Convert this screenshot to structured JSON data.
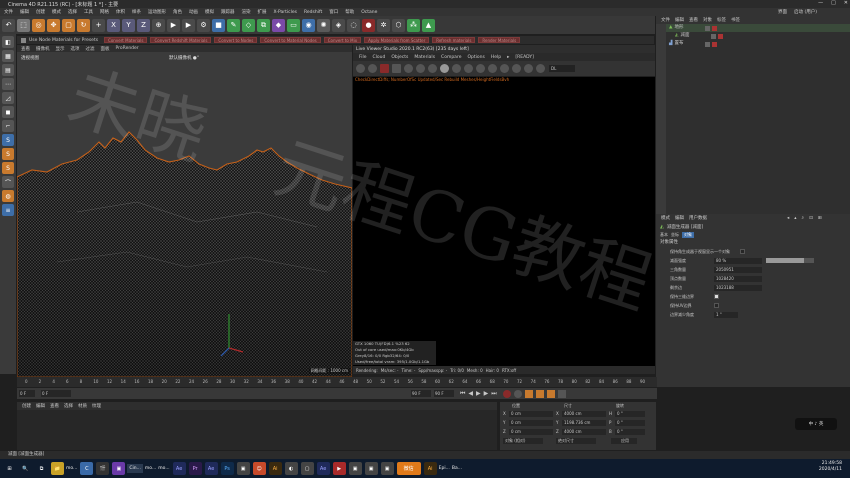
{
  "window": {
    "title": "Cinema 4D R21.115 (RC) - [未标题 1 *] - 主要",
    "controls": [
      "—",
      "□",
      "✕"
    ]
  },
  "menubar": {
    "items": [
      "文件",
      "编辑",
      "创建",
      "模式",
      "选择",
      "工具",
      "网格",
      "体积",
      "样条",
      "运动图形",
      "角色",
      "动画",
      "模拟",
      "跟踪器",
      "渲染",
      "扩展",
      "X-Particles",
      "Redshift",
      "窗口",
      "帮助",
      "Octane"
    ],
    "interface_label": "界面",
    "interface_value": "启动 (用户)"
  },
  "nodestrip": {
    "label": "Use Node Materials for Presets",
    "buttons": [
      "Convert Materials",
      "Convert Redshift Materials",
      "Convert to Nodes",
      "Convert to Material Nodes",
      "Convert to Mix",
      "Apply Materials from Scatter",
      "Refresh materials",
      "Render Materials"
    ]
  },
  "viewport": {
    "tabs": [
      "查看",
      "摄像机",
      "显示",
      "选项",
      "过滤",
      "面板",
      "ProRender"
    ],
    "title": "透视视图",
    "camera": "默认摄像机 ●°",
    "scale": "网格间距 : 1000 cm"
  },
  "liveviewer": {
    "title": "Live Viewer Studio 2020.1 RC2(63) [235 days left]",
    "menu": [
      "File",
      "Cloud",
      "Objects",
      "Materials",
      "Compare",
      "Options",
      "Help",
      "▸",
      "[READY]"
    ],
    "mode": "DL",
    "status": "CheckDirectDiffs; NumberOfSc Updated/Sec Rebuild Meshes/HeightFieldsBvh",
    "info": [
      "GTX 1060 TU(FD)6.1    %23    62",
      "Out of core used/max:0Kb/4Gb",
      "Grey8/16: 0/0     Rgb32/64: 0/0",
      "Used/free/total vram: 395/1.0Gb/1.1Gb"
    ],
    "bottom": [
      "Rendering:",
      "Ms/sec: -",
      "Time: -",
      "Spp/maxspp: -",
      "Tri: 0/0",
      "Mesh: 0",
      "Hair: 0",
      "RTX:off"
    ]
  },
  "objects": {
    "tabs": [
      "文件",
      "编辑",
      "查看",
      "对象",
      "标签",
      "书签"
    ],
    "items": [
      {
        "name": "地形",
        "icon": "terrain-icon"
      },
      {
        "name": "减面",
        "icon": "polyreduction-icon"
      },
      {
        "name": "置布",
        "icon": "cloth-icon"
      }
    ]
  },
  "attributes": {
    "tabs": [
      "模式",
      "编辑",
      "用户数据"
    ],
    "object_name": "减面生成器 [减面]",
    "subtabs": [
      "基本",
      "坐标",
      "对象"
    ],
    "section": "对象属性",
    "rows": [
      {
        "label": "保持角生成器于视窗显示一个对象",
        "type": "checkbox",
        "checked": false
      },
      {
        "label": "减面强度",
        "type": "slider",
        "value": "80 %",
        "fraction": 0.8
      },
      {
        "label": "三角数量",
        "type": "field",
        "value": "2050951"
      },
      {
        "label": "顶点数量",
        "type": "field",
        "value": "1028420"
      },
      {
        "label": "剩余边",
        "type": "field",
        "value": "1023188"
      },
      {
        "label": "保持三维边界",
        "type": "checkbox",
        "checked": true
      },
      {
        "label": "保持UV边界",
        "type": "checkbox",
        "checked": false
      },
      {
        "label": "边界减少角度",
        "type": "field",
        "value": "1 °"
      }
    ]
  },
  "timeline": {
    "ticks": [
      "0",
      "2",
      "4",
      "6",
      "8",
      "10",
      "12",
      "14",
      "16",
      "18",
      "20",
      "22",
      "24",
      "26",
      "28",
      "30",
      "32",
      "34",
      "36",
      "38",
      "40",
      "42",
      "44",
      "46",
      "48",
      "50",
      "52",
      "54",
      "56",
      "58",
      "60",
      "62",
      "64",
      "66",
      "68",
      "70",
      "72",
      "74",
      "76",
      "78",
      "80",
      "82",
      "84",
      "86",
      "88",
      "90"
    ],
    "current_frame": "0 F",
    "start": "0 F",
    "end": "90 F",
    "end2": "90 F",
    "right_frame": "0 F"
  },
  "materials": {
    "tabs": [
      "创建",
      "编辑",
      "查看",
      "选择",
      "材质",
      "纹理"
    ]
  },
  "coordinates": {
    "headers": [
      "位置",
      "尺寸",
      "旋转"
    ],
    "rows": [
      {
        "axis": "X",
        "pos": "0 cm",
        "size_axis": "X",
        "size": "4000 cm",
        "rot_axis": "H",
        "rot": "0 °"
      },
      {
        "axis": "Y",
        "pos": "0 cm",
        "size_axis": "Y",
        "size": "1198.736 cm",
        "rot_axis": "P",
        "rot": "0 °"
      },
      {
        "axis": "Z",
        "pos": "0 cm",
        "size_axis": "Z",
        "size": "4000 cm",
        "rot_axis": "B",
        "rot": "0 °"
      }
    ],
    "mode1": "对象 (相对)",
    "mode2": "绝对尺寸",
    "apply": "应用"
  },
  "statusbar": "减面 [减面生成器]",
  "watermark": [
    "未晓",
    "元程CG教程"
  ],
  "ime": "中 ♪ 英",
  "taskbar": {
    "items": [
      "⊞",
      "🔍",
      "⧉",
      "📁",
      "mo...",
      "C",
      "🎬",
      "▣",
      "Cin...",
      "mo...",
      "mo...",
      "Ae",
      "Pr",
      "Ae",
      "Ps",
      "▣",
      "☺",
      "Ai",
      "◐",
      "▢",
      "Ae",
      "▶",
      "▣",
      "▣",
      "▣",
      "微信",
      "Ai",
      "Epi...",
      "Ba..."
    ],
    "time": "21:49:58",
    "date": "2020/4/11"
  },
  "colors": {
    "accent_orange": "#d2691e",
    "taskbar": "#0e1b2d",
    "terrain_edge": "#c8621a"
  }
}
